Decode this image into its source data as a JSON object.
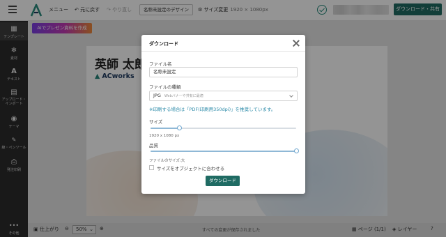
{
  "colors": {
    "accent": "#1f6b63",
    "sidebar_bg": "#2b2b2b",
    "note_blue": "#2b8aa8"
  },
  "topbar": {
    "menu_label": "メニュー",
    "undo_label": "元に戻す",
    "redo_label": "やり直し",
    "design_name": "名称未設定のデザイン",
    "size_change_label": "サイズ変更",
    "size_dims": "1920 × 1080px",
    "download_share_label": "ダウンロード・共有",
    "icons": [
      "hamburger-icon",
      "logo-icon",
      "undo-icon",
      "redo-icon",
      "gear-icon",
      "check-circle-icon"
    ]
  },
  "sidebar": {
    "items": [
      {
        "label": "テンプレート",
        "icon": "template-icon"
      },
      {
        "label": "素材",
        "icon": "element-icon"
      },
      {
        "label": "テキスト",
        "icon": "text-icon"
      },
      {
        "label": "アップロード・インポート",
        "icon": "upload-icon"
      },
      {
        "label": "テーマ",
        "icon": "palette-icon"
      },
      {
        "label": "線・ペンツール",
        "icon": "pen-icon"
      },
      {
        "label": "発注印刷",
        "icon": "printer-icon"
      },
      {
        "label": "その他",
        "icon": "more-icon"
      }
    ]
  },
  "workarea": {
    "ai_button_label": "AIでプレゼン資料を作成",
    "canvas_title": "英師 太郎",
    "canvas_logo_text": "ACworks"
  },
  "bottombar": {
    "finish_label": "仕上がり",
    "zoom_value": "50%",
    "saved_message": "すべての変更が保存されました",
    "page_label": "ページ (1/1)",
    "layer_label": "レイヤー"
  },
  "modal": {
    "title": "ダウンロード",
    "file_name_label": "ファイル名",
    "file_name_value": "名称未設定",
    "file_type_label": "ファイルの種類",
    "file_type_value": "JPG",
    "file_type_hint": "Webバナーや共有に最適",
    "print_note": "※印刷する場合は「PDF(印刷用350dpi)」を推奨しています。",
    "size_label": "サイズ",
    "size_fraction": 0.2,
    "size_value": "1920 x 1080 px",
    "quality_label": "品質",
    "quality_fraction": 1.0,
    "file_size_label": "ファイルのサイズ:大",
    "fit_object_label": "サイズをオブジェクトに合わせる",
    "fit_object_checked": false,
    "download_button_label": "ダウンロード"
  }
}
